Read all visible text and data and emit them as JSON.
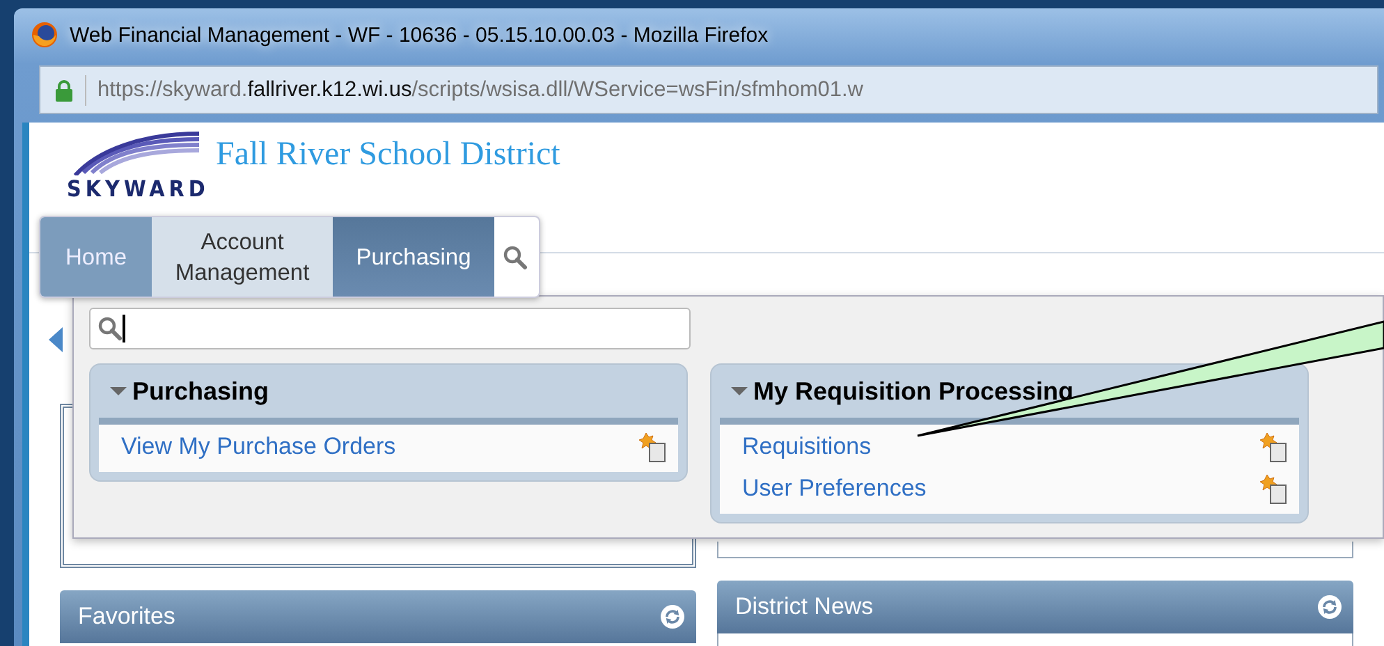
{
  "window": {
    "title": "Web Financial Management - WF - 10636 - 05.15.10.00.03 - Mozilla Firefox"
  },
  "address_bar": {
    "url_parts": [
      {
        "text": "https://skyward.",
        "kind": "muted"
      },
      {
        "text": "fallriver.k12.wi.us",
        "kind": "domain"
      },
      {
        "text": "/scripts/wsisa.dll/WService=wsFin/sfmhom01.w",
        "kind": "muted"
      }
    ]
  },
  "site": {
    "logo_text": "SKYWARD",
    "title": "Fall River School District"
  },
  "nav_tabs": [
    {
      "label": "Home",
      "current": true,
      "selected": false
    },
    {
      "label": "Account Management",
      "current": false,
      "selected": false
    },
    {
      "label": "Purchasing",
      "current": false,
      "selected": true
    }
  ],
  "menu": {
    "groups": [
      {
        "title": "Purchasing",
        "expanded": true,
        "items": [
          {
            "label": "View My Purchase Orders"
          }
        ]
      },
      {
        "title": "My Requisition Processing",
        "expanded": true,
        "items": [
          {
            "label": "Requisitions"
          },
          {
            "label": "User Preferences"
          }
        ]
      }
    ]
  },
  "widgets": [
    {
      "title": "Favorites"
    },
    {
      "title": "District News"
    }
  ]
}
